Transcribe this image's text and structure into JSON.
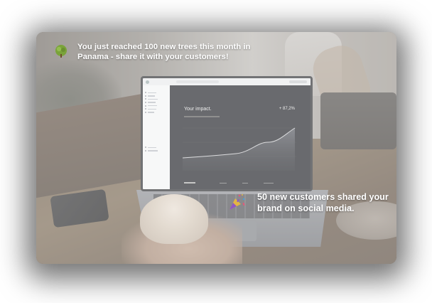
{
  "notifications": {
    "trees_message": "You just reached 100 new trees this month in Panama - share it with your customers!",
    "customers_message": "50 new customers shared your brand on social media."
  },
  "laptop_screen": {
    "impact_title": "Your impact.",
    "impact_value": "+ 87,2%"
  },
  "icons": {
    "tree": "tree-icon",
    "party": "party-popper-icon"
  },
  "colors": {
    "message_text": "#ffffff",
    "tree_green": "#7aa33a",
    "confetti_gold": "#e3b543",
    "confetti_purple": "#8e58c4"
  }
}
